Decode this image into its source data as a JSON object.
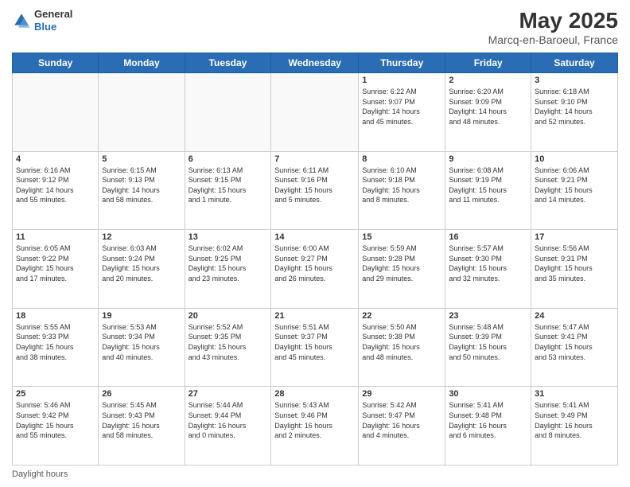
{
  "logo": {
    "line1": "General",
    "line2": "Blue"
  },
  "title": "May 2025",
  "subtitle": "Marcq-en-Baroeul, France",
  "days_of_week": [
    "Sunday",
    "Monday",
    "Tuesday",
    "Wednesday",
    "Thursday",
    "Friday",
    "Saturday"
  ],
  "footer_label": "Daylight hours",
  "weeks": [
    [
      {
        "day": "",
        "info": ""
      },
      {
        "day": "",
        "info": ""
      },
      {
        "day": "",
        "info": ""
      },
      {
        "day": "",
        "info": ""
      },
      {
        "day": "1",
        "info": "Sunrise: 6:22 AM\nSunset: 9:07 PM\nDaylight: 14 hours\nand 45 minutes."
      },
      {
        "day": "2",
        "info": "Sunrise: 6:20 AM\nSunset: 9:09 PM\nDaylight: 14 hours\nand 48 minutes."
      },
      {
        "day": "3",
        "info": "Sunrise: 6:18 AM\nSunset: 9:10 PM\nDaylight: 14 hours\nand 52 minutes."
      }
    ],
    [
      {
        "day": "4",
        "info": "Sunrise: 6:16 AM\nSunset: 9:12 PM\nDaylight: 14 hours\nand 55 minutes."
      },
      {
        "day": "5",
        "info": "Sunrise: 6:15 AM\nSunset: 9:13 PM\nDaylight: 14 hours\nand 58 minutes."
      },
      {
        "day": "6",
        "info": "Sunrise: 6:13 AM\nSunset: 9:15 PM\nDaylight: 15 hours\nand 1 minute."
      },
      {
        "day": "7",
        "info": "Sunrise: 6:11 AM\nSunset: 9:16 PM\nDaylight: 15 hours\nand 5 minutes."
      },
      {
        "day": "8",
        "info": "Sunrise: 6:10 AM\nSunset: 9:18 PM\nDaylight: 15 hours\nand 8 minutes."
      },
      {
        "day": "9",
        "info": "Sunrise: 6:08 AM\nSunset: 9:19 PM\nDaylight: 15 hours\nand 11 minutes."
      },
      {
        "day": "10",
        "info": "Sunrise: 6:06 AM\nSunset: 9:21 PM\nDaylight: 15 hours\nand 14 minutes."
      }
    ],
    [
      {
        "day": "11",
        "info": "Sunrise: 6:05 AM\nSunset: 9:22 PM\nDaylight: 15 hours\nand 17 minutes."
      },
      {
        "day": "12",
        "info": "Sunrise: 6:03 AM\nSunset: 9:24 PM\nDaylight: 15 hours\nand 20 minutes."
      },
      {
        "day": "13",
        "info": "Sunrise: 6:02 AM\nSunset: 9:25 PM\nDaylight: 15 hours\nand 23 minutes."
      },
      {
        "day": "14",
        "info": "Sunrise: 6:00 AM\nSunset: 9:27 PM\nDaylight: 15 hours\nand 26 minutes."
      },
      {
        "day": "15",
        "info": "Sunrise: 5:59 AM\nSunset: 9:28 PM\nDaylight: 15 hours\nand 29 minutes."
      },
      {
        "day": "16",
        "info": "Sunrise: 5:57 AM\nSunset: 9:30 PM\nDaylight: 15 hours\nand 32 minutes."
      },
      {
        "day": "17",
        "info": "Sunrise: 5:56 AM\nSunset: 9:31 PM\nDaylight: 15 hours\nand 35 minutes."
      }
    ],
    [
      {
        "day": "18",
        "info": "Sunrise: 5:55 AM\nSunset: 9:33 PM\nDaylight: 15 hours\nand 38 minutes."
      },
      {
        "day": "19",
        "info": "Sunrise: 5:53 AM\nSunset: 9:34 PM\nDaylight: 15 hours\nand 40 minutes."
      },
      {
        "day": "20",
        "info": "Sunrise: 5:52 AM\nSunset: 9:35 PM\nDaylight: 15 hours\nand 43 minutes."
      },
      {
        "day": "21",
        "info": "Sunrise: 5:51 AM\nSunset: 9:37 PM\nDaylight: 15 hours\nand 45 minutes."
      },
      {
        "day": "22",
        "info": "Sunrise: 5:50 AM\nSunset: 9:38 PM\nDaylight: 15 hours\nand 48 minutes."
      },
      {
        "day": "23",
        "info": "Sunrise: 5:48 AM\nSunset: 9:39 PM\nDaylight: 15 hours\nand 50 minutes."
      },
      {
        "day": "24",
        "info": "Sunrise: 5:47 AM\nSunset: 9:41 PM\nDaylight: 15 hours\nand 53 minutes."
      }
    ],
    [
      {
        "day": "25",
        "info": "Sunrise: 5:46 AM\nSunset: 9:42 PM\nDaylight: 15 hours\nand 55 minutes."
      },
      {
        "day": "26",
        "info": "Sunrise: 5:45 AM\nSunset: 9:43 PM\nDaylight: 15 hours\nand 58 minutes."
      },
      {
        "day": "27",
        "info": "Sunrise: 5:44 AM\nSunset: 9:44 PM\nDaylight: 16 hours\nand 0 minutes."
      },
      {
        "day": "28",
        "info": "Sunrise: 5:43 AM\nSunset: 9:46 PM\nDaylight: 16 hours\nand 2 minutes."
      },
      {
        "day": "29",
        "info": "Sunrise: 5:42 AM\nSunset: 9:47 PM\nDaylight: 16 hours\nand 4 minutes."
      },
      {
        "day": "30",
        "info": "Sunrise: 5:41 AM\nSunset: 9:48 PM\nDaylight: 16 hours\nand 6 minutes."
      },
      {
        "day": "31",
        "info": "Sunrise: 5:41 AM\nSunset: 9:49 PM\nDaylight: 16 hours\nand 8 minutes."
      }
    ]
  ]
}
